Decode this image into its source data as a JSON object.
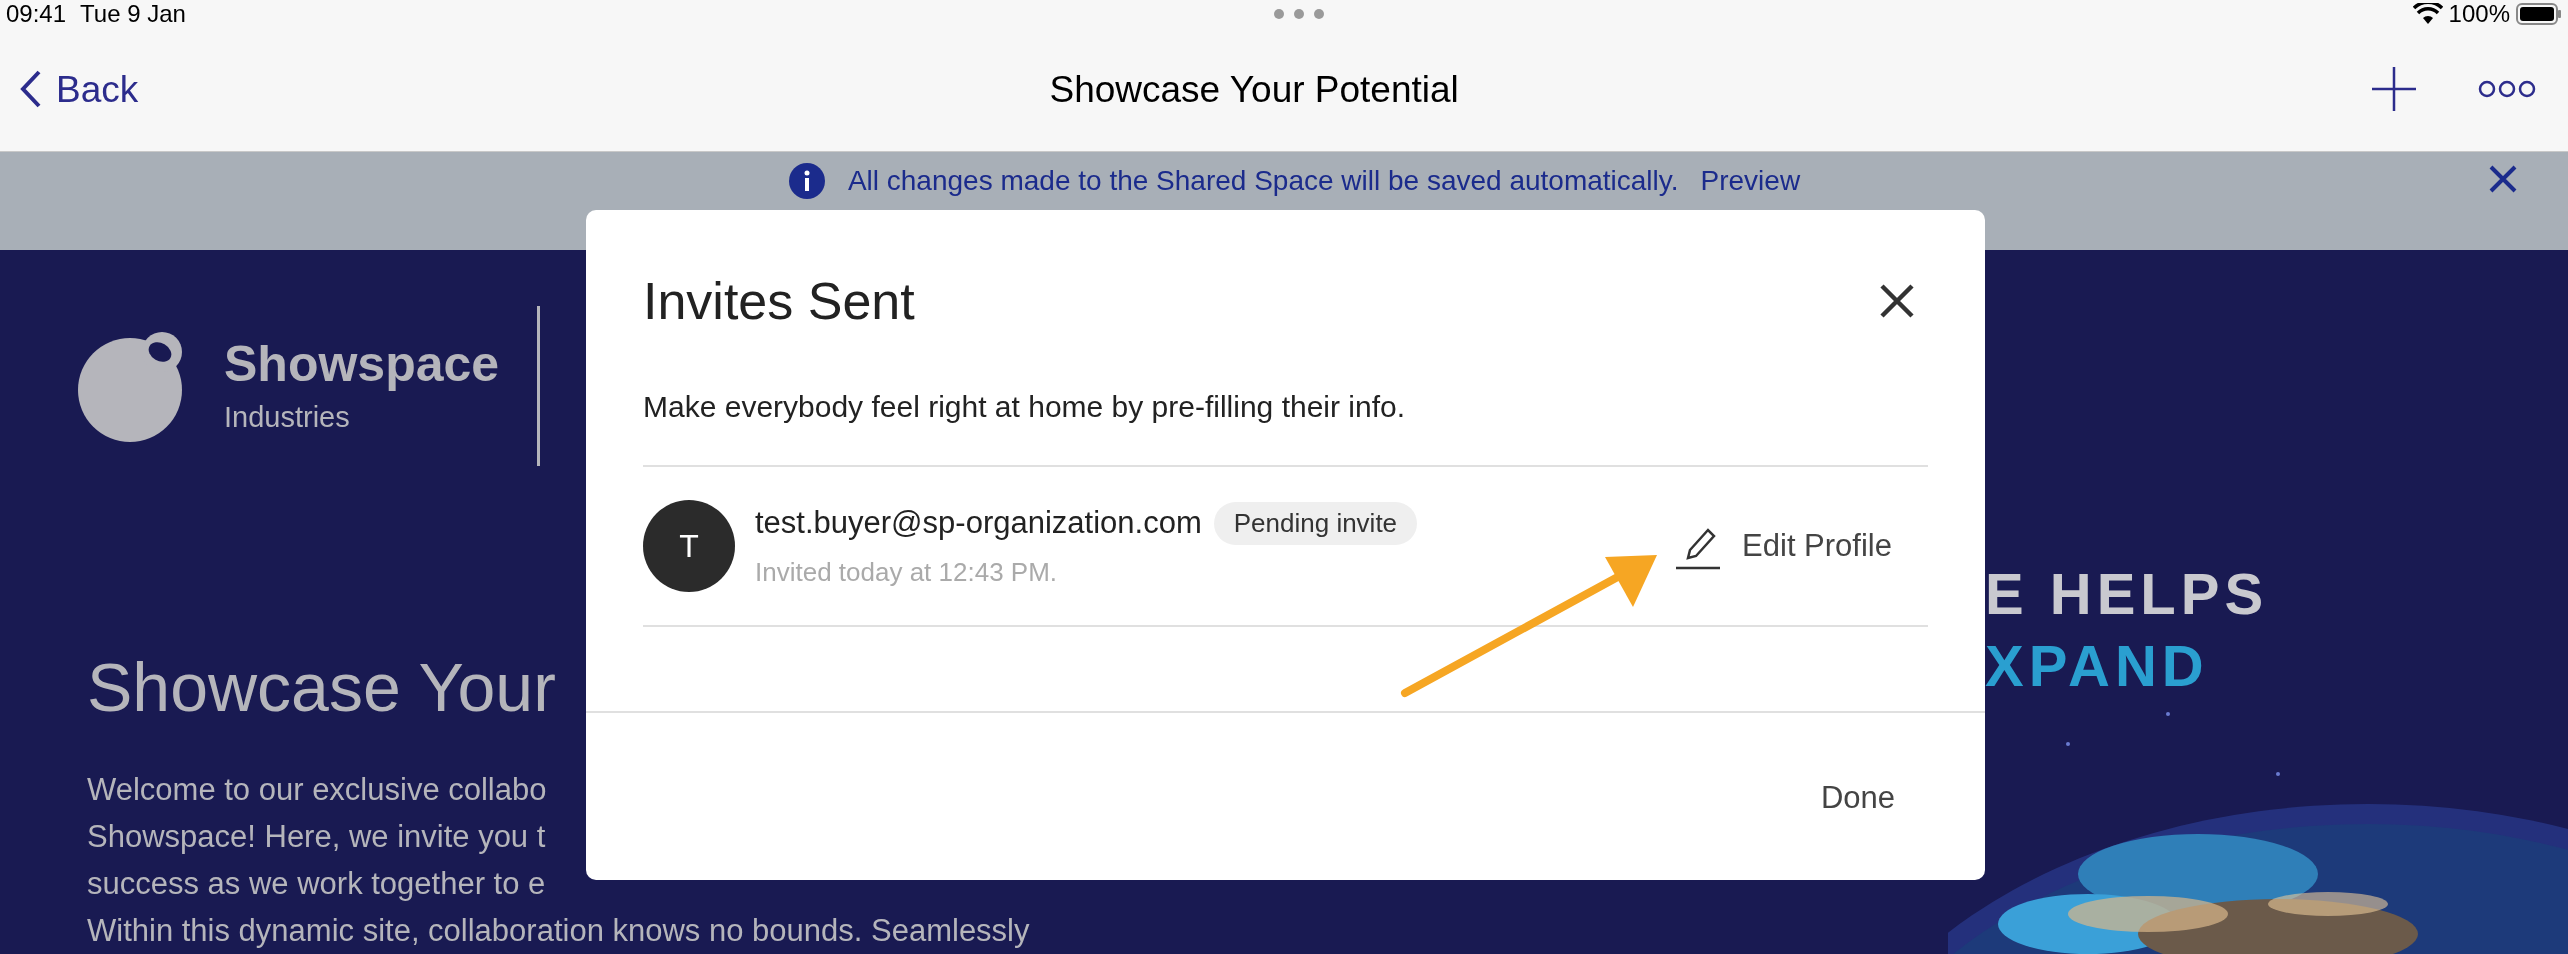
{
  "status_bar": {
    "time": "09:41",
    "date": "Tue 9 Jan",
    "battery": "100%"
  },
  "nav_bar": {
    "back": "Back",
    "title": "Showcase Your Potential"
  },
  "banner": {
    "message": "All changes made to the Shared Space will be saved automatically.",
    "link": "Preview"
  },
  "page": {
    "brand_name": "Showspace",
    "brand_sub": "Industries",
    "heading": "Showcase Your",
    "paragraph_lines": [
      "Welcome to our exclusive collabo",
      "Showspace! Here, we invite you t",
      "success as we work together to e",
      "Within this dynamic site, collaboration knows no bounds. Seamlessly"
    ],
    "hero_lines": [
      {
        "text": "E HELPS",
        "kind": "plain"
      },
      {
        "text": "XPAND",
        "kind": "accent"
      }
    ]
  },
  "dialog": {
    "title": "Invites Sent",
    "description": "Make everybody feel right at home by pre-filling their info.",
    "invites": [
      {
        "initial": "T",
        "email": "test.buyer@sp-organization.com",
        "status": "Pending invite",
        "time": "Invited today at 12:43 PM.",
        "action": "Edit Profile"
      }
    ],
    "done": "Done"
  }
}
